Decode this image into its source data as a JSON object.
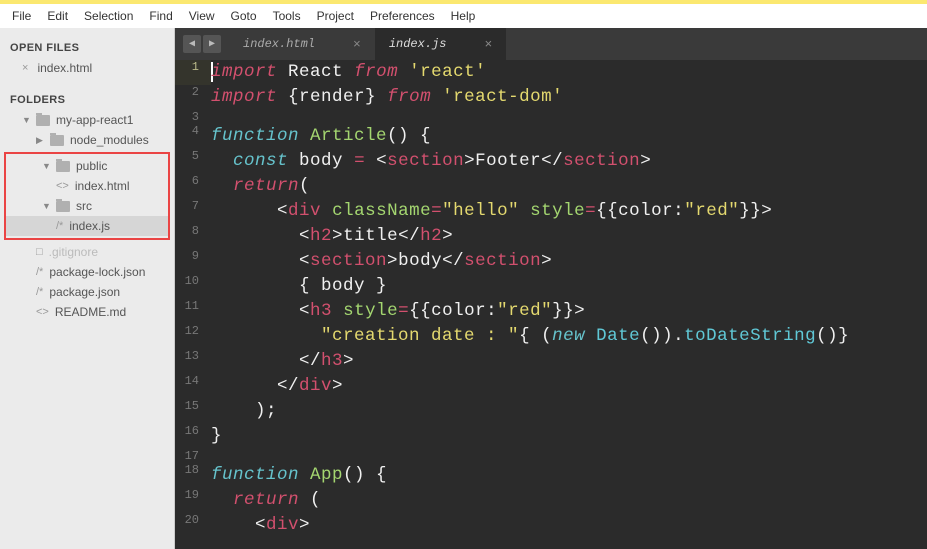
{
  "menu": [
    "File",
    "Edit",
    "Selection",
    "Find",
    "View",
    "Goto",
    "Tools",
    "Project",
    "Preferences",
    "Help"
  ],
  "sidebar": {
    "open_files_label": "OPEN FILES",
    "folders_label": "FOLDERS",
    "open_files": [
      {
        "name": "index.html",
        "icon": "×"
      }
    ],
    "root": "my-app-react1",
    "node_modules": "node_modules",
    "highlighted": {
      "public": "public",
      "public_file": "index.html",
      "public_file_icon": "<>",
      "src": "src",
      "src_file": "index.js",
      "src_file_icon": "/*"
    },
    "rest": [
      {
        "icon": "□",
        "name": ".gitignore",
        "faded": true
      },
      {
        "icon": "/*",
        "name": "package-lock.json"
      },
      {
        "icon": "/*",
        "name": "package.json"
      },
      {
        "icon": "<>",
        "name": "README.md"
      }
    ]
  },
  "tabs": {
    "inactive": "index.html",
    "active": "index.js"
  },
  "lines": {
    "l1": {
      "n": "1",
      "tokens": [
        [
          "k-red",
          "import"
        ],
        [
          "k-gray",
          " "
        ],
        [
          "k-white",
          "React"
        ],
        [
          "k-gray",
          " "
        ],
        [
          "k-red",
          "from"
        ],
        [
          "k-gray",
          " "
        ],
        [
          "k-yellow",
          "'react'"
        ]
      ]
    },
    "l2": {
      "n": "2",
      "tokens": [
        [
          "k-red",
          "import"
        ],
        [
          "k-gray",
          " "
        ],
        [
          "k-white",
          "{render}"
        ],
        [
          "k-gray",
          " "
        ],
        [
          "k-red",
          "from"
        ],
        [
          "k-gray",
          " "
        ],
        [
          "k-yellow",
          "'react-dom'"
        ]
      ]
    },
    "l3": {
      "n": "3",
      "tokens": []
    },
    "l4": {
      "n": "4",
      "tokens": [
        [
          "k-blue",
          "function"
        ],
        [
          "k-gray",
          " "
        ],
        [
          "k-green",
          "Article"
        ],
        [
          "k-white",
          "() {"
        ]
      ]
    },
    "l5": {
      "n": "5",
      "tokens": [
        [
          "k-gray",
          "  "
        ],
        [
          "k-blue",
          "const"
        ],
        [
          "k-gray",
          " "
        ],
        [
          "k-white",
          "body "
        ],
        [
          "k-red",
          "="
        ],
        [
          "k-gray",
          " "
        ],
        [
          "k-white",
          "<"
        ],
        [
          "k-pink",
          "section"
        ],
        [
          "k-white",
          ">"
        ],
        [
          "k-gray",
          "Footer"
        ],
        [
          "k-white",
          "</"
        ],
        [
          "k-pink",
          "section"
        ],
        [
          "k-white",
          ">"
        ]
      ]
    },
    "l6": {
      "n": "6",
      "tokens": [
        [
          "k-gray",
          "  "
        ],
        [
          "k-red",
          "return"
        ],
        [
          "k-white",
          "("
        ]
      ]
    },
    "l7": {
      "n": "7",
      "tokens": [
        [
          "k-gray",
          "      "
        ],
        [
          "k-white",
          "<"
        ],
        [
          "k-pink",
          "div"
        ],
        [
          "k-gray",
          " "
        ],
        [
          "k-green",
          "className"
        ],
        [
          "k-red",
          "="
        ],
        [
          "k-yellow",
          "\"hello\""
        ],
        [
          "k-gray",
          " "
        ],
        [
          "k-green",
          "style"
        ],
        [
          "k-red",
          "="
        ],
        [
          "k-white",
          "{{"
        ],
        [
          "k-gray",
          "color:"
        ],
        [
          "k-yellow",
          "\"red\""
        ],
        [
          "k-white",
          "}}>"
        ]
      ]
    },
    "l8": {
      "n": "8",
      "tokens": [
        [
          "k-gray",
          "        "
        ],
        [
          "k-white",
          "<"
        ],
        [
          "k-pink",
          "h2"
        ],
        [
          "k-white",
          ">"
        ],
        [
          "k-gray",
          "title"
        ],
        [
          "k-white",
          "</"
        ],
        [
          "k-pink",
          "h2"
        ],
        [
          "k-white",
          ">"
        ]
      ]
    },
    "l9": {
      "n": "9",
      "tokens": [
        [
          "k-gray",
          "        "
        ],
        [
          "k-white",
          "<"
        ],
        [
          "k-pink",
          "section"
        ],
        [
          "k-white",
          ">"
        ],
        [
          "k-gray",
          "body"
        ],
        [
          "k-white",
          "</"
        ],
        [
          "k-pink",
          "section"
        ],
        [
          "k-white",
          ">"
        ]
      ]
    },
    "l10": {
      "n": "10",
      "tokens": [
        [
          "k-gray",
          "        "
        ],
        [
          "k-white",
          "{ body }"
        ]
      ]
    },
    "l11": {
      "n": "11",
      "tokens": [
        [
          "k-gray",
          "        "
        ],
        [
          "k-white",
          "<"
        ],
        [
          "k-pink",
          "h3"
        ],
        [
          "k-gray",
          " "
        ],
        [
          "k-green",
          "style"
        ],
        [
          "k-red",
          "="
        ],
        [
          "k-white",
          "{{"
        ],
        [
          "k-gray",
          "color:"
        ],
        [
          "k-yellow",
          "\"red\""
        ],
        [
          "k-white",
          "}}>"
        ]
      ]
    },
    "l12": {
      "n": "12",
      "tokens": [
        [
          "k-gray",
          "          "
        ],
        [
          "k-yellow",
          "\"creation date : \""
        ],
        [
          "k-white",
          "{ ("
        ],
        [
          "k-blue",
          "new"
        ],
        [
          "k-gray",
          " "
        ],
        [
          "k-lightblue",
          "Date"
        ],
        [
          "k-white",
          "())."
        ],
        [
          "k-lightblue",
          "toDateString"
        ],
        [
          "k-white",
          "()}"
        ]
      ]
    },
    "l13": {
      "n": "13",
      "tokens": [
        [
          "k-gray",
          "        "
        ],
        [
          "k-white",
          "</"
        ],
        [
          "k-pink",
          "h3"
        ],
        [
          "k-white",
          ">"
        ]
      ]
    },
    "l14": {
      "n": "14",
      "tokens": [
        [
          "k-gray",
          "      "
        ],
        [
          "k-white",
          "</"
        ],
        [
          "k-pink",
          "div"
        ],
        [
          "k-white",
          ">"
        ]
      ]
    },
    "l15": {
      "n": "15",
      "tokens": [
        [
          "k-gray",
          "    "
        ],
        [
          "k-white",
          ");"
        ]
      ]
    },
    "l16": {
      "n": "16",
      "tokens": [
        [
          "k-white",
          "}"
        ]
      ]
    },
    "l17": {
      "n": "17",
      "tokens": []
    },
    "l18": {
      "n": "18",
      "tokens": [
        [
          "k-blue",
          "function"
        ],
        [
          "k-gray",
          " "
        ],
        [
          "k-green",
          "App"
        ],
        [
          "k-white",
          "() {"
        ]
      ]
    },
    "l19": {
      "n": "19",
      "tokens": [
        [
          "k-gray",
          "  "
        ],
        [
          "k-red",
          "return"
        ],
        [
          "k-gray",
          " "
        ],
        [
          "k-white",
          "("
        ]
      ]
    },
    "l20": {
      "n": "20",
      "tokens": [
        [
          "k-gray",
          "    "
        ],
        [
          "k-white",
          "<"
        ],
        [
          "k-pink",
          "div"
        ],
        [
          "k-white",
          ">"
        ]
      ]
    }
  }
}
